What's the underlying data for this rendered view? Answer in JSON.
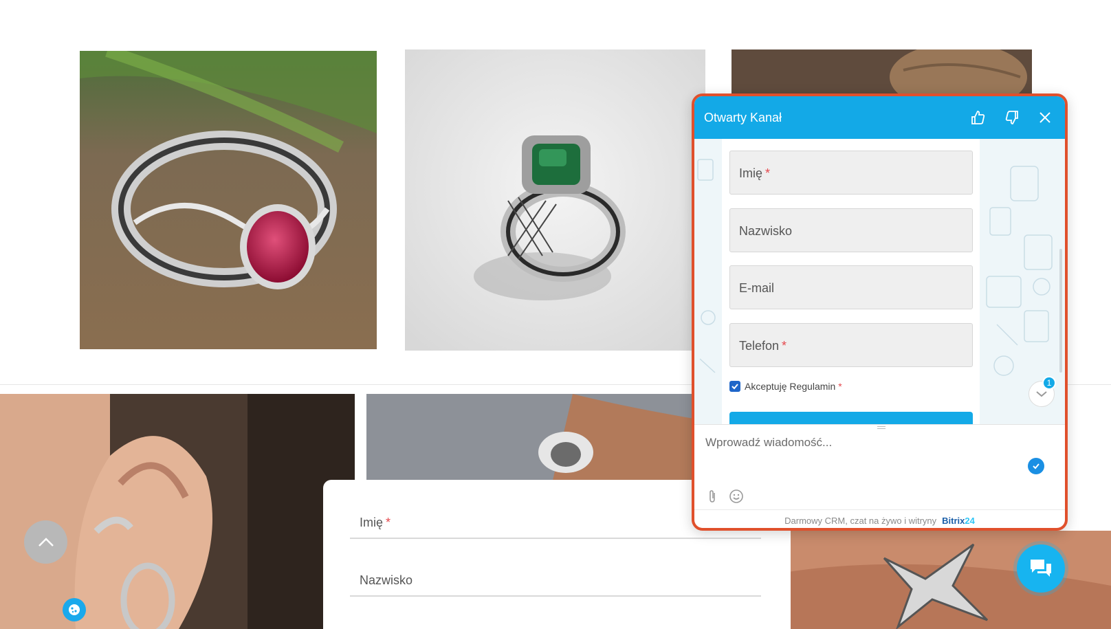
{
  "colors": {
    "accent": "#13a9e7",
    "chat_border": "#e0502c",
    "required": "#e5484d"
  },
  "gallery": [
    {
      "name": "ruby-ring-photo"
    },
    {
      "name": "emerald-ring-photo"
    },
    {
      "name": "wood-photo"
    },
    {
      "name": "ear-cuff-photo"
    },
    {
      "name": "silver-ring-photo"
    },
    {
      "name": "star-ring-photo"
    }
  ],
  "page_form": {
    "first_name_label": "Imię",
    "last_name_label": "Nazwisko",
    "required_mark": "*"
  },
  "chat": {
    "title": "Otwarty Kanał",
    "form": {
      "first_name_label": "Imię",
      "last_name_label": "Nazwisko",
      "email_label": "E-mail",
      "phone_label": "Telefon",
      "terms_label": "Akceptuję Regulamin",
      "terms_checked": true,
      "required_mark": "*"
    },
    "unread_count": "1",
    "message_placeholder": "Wprowadź wiadomość...",
    "footer_text": "Darmowy CRM, czat na żywo i witryny",
    "footer_brand_a": "Bitrix",
    "footer_brand_b": "24"
  },
  "icons": {
    "like": "thumbs-up-icon",
    "dislike": "thumbs-down-icon",
    "close": "close-icon",
    "attach": "paperclip-icon",
    "emoji": "smile-icon",
    "send": "check-icon",
    "scroll_top": "chevron-up-icon",
    "cookie": "cookie-icon",
    "launcher": "chat-bubbles-icon"
  }
}
